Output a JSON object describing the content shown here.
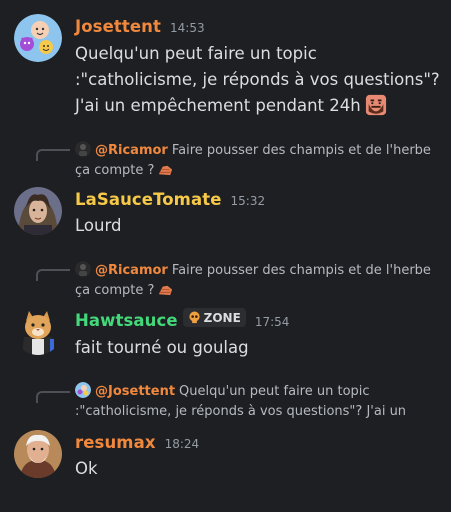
{
  "colors": {
    "background": "#1e1f22",
    "josettent": "#f0883e",
    "ricamor": "#f0883e",
    "lasaucetomate": "#f7c948",
    "hawtsauce": "#43d97a",
    "resumax": "#f0883e"
  },
  "messages": [
    {
      "username": "Josettent",
      "timestamp": "14:53",
      "text": "Quelqu'un peut faire un topic :\"catholicisme, je réponds à vos questions\"? J'ai un empêchement pendant 24h",
      "emoji": "bearded-face-emoji"
    },
    {
      "reply": {
        "mention": "@Ricamor",
        "text": "Faire pousser des champis et de l'herbe ça compte ?"
      },
      "username": "LaSauceTomate",
      "timestamp": "15:32",
      "text": "Lourd"
    },
    {
      "reply": {
        "mention": "@Ricamor",
        "text": "Faire pousser des champis et de l'herbe ça compte ?"
      },
      "username": "Hawtsauce",
      "tag": "ZONE",
      "timestamp": "17:54",
      "text": "fait tourné ou goulag"
    },
    {
      "reply": {
        "mention": "@Josettent",
        "text": "Quelqu'un peut faire un topic :\"catholicisme, je réponds à vos questions\"? J'ai un"
      },
      "username": "resumax",
      "timestamp": "18:24",
      "text": "Ok"
    }
  ]
}
